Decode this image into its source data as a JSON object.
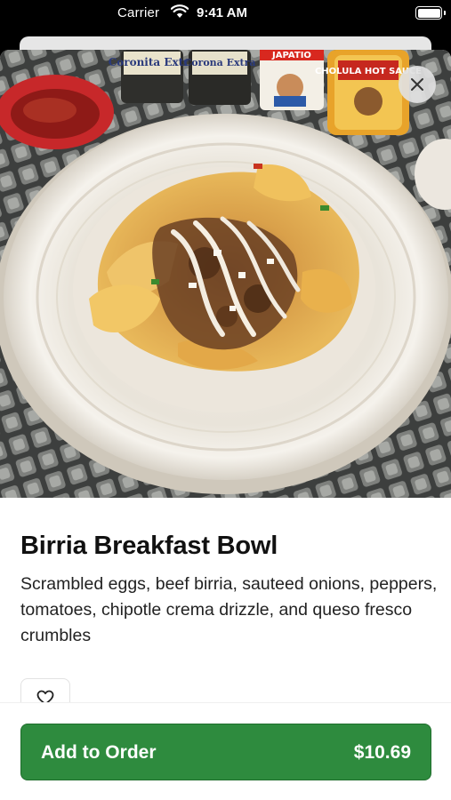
{
  "status_bar": {
    "carrier": "Carrier",
    "time": "9:41 AM"
  },
  "hero": {
    "bottle_labels": [
      "Coronita Extra",
      "Corona Extra",
      "JAPATIO",
      "CHOLULA HOT SAUCE"
    ]
  },
  "item": {
    "name": "Birria Breakfast Bowl",
    "description": "Scrambled eggs, beef birria, sauteed onions, peppers, tomatoes, chipotle crema drizzle, and queso fresco crumbles"
  },
  "actions": {
    "add_label": "Add to Order",
    "price": "$10.69"
  },
  "icons": {
    "close": "close-icon",
    "favorite": "heart-icon",
    "wifi": "wifi-icon",
    "battery": "battery-icon"
  },
  "colors": {
    "primary": "#2e8b3e",
    "text": "#111111"
  }
}
